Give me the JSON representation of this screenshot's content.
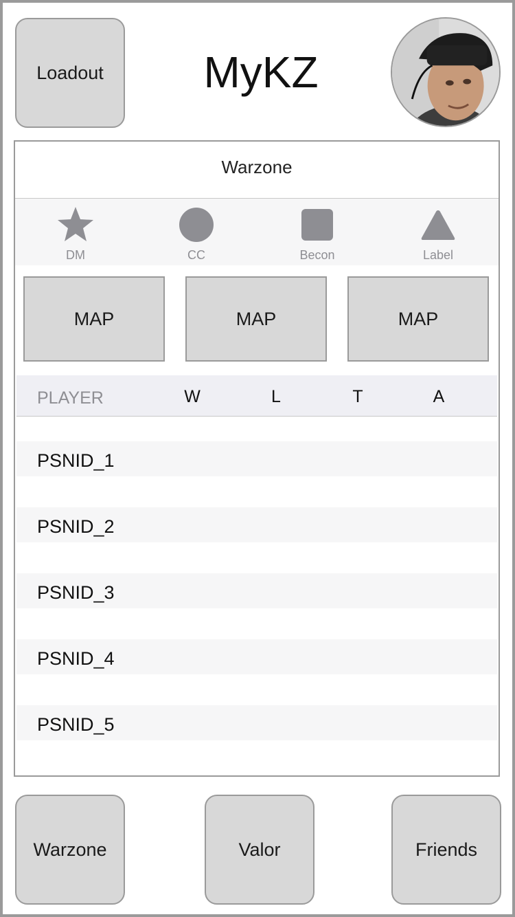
{
  "header": {
    "loadout_label": "Loadout",
    "title": "MyKZ",
    "avatar_alt": "user avatar"
  },
  "panel": {
    "title": "Warzone",
    "tabs": [
      {
        "label": "DM",
        "icon": "star-icon"
      },
      {
        "label": "CC",
        "icon": "circle-icon"
      },
      {
        "label": "Becon",
        "icon": "square-icon"
      },
      {
        "label": "Label",
        "icon": "triangle-icon"
      }
    ],
    "maps": [
      "MAP",
      "MAP",
      "MAP"
    ],
    "table": {
      "columns": [
        "PLAYER",
        "W",
        "L",
        "T",
        "A"
      ],
      "rows": [
        "PSNID_1",
        "PSNID_2",
        "PSNID_3",
        "PSNID_4",
        "PSNID_5"
      ]
    }
  },
  "footer": {
    "buttons": [
      "Warzone",
      "Valor",
      "Friends"
    ]
  },
  "colors": {
    "button_fill": "#d8d8d8",
    "border": "#9a9a9a",
    "icon_gray": "#8e8e93",
    "row_stripe": "#f6f6f7",
    "header_fill": "#efeff4"
  }
}
